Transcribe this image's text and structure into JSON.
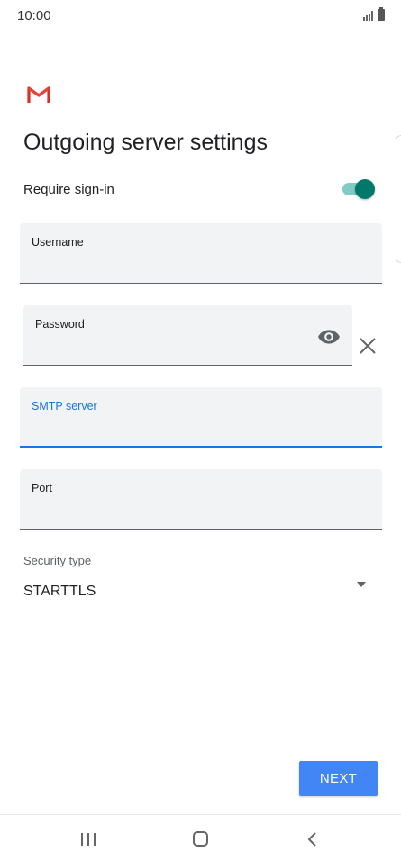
{
  "status_bar": {
    "time": "10:00"
  },
  "header": {
    "logo_icon": "gmail-logo-icon",
    "title": "Outgoing server settings"
  },
  "require_signin": {
    "label": "Require sign-in",
    "enabled": true
  },
  "fields": {
    "username": {
      "label": "Username",
      "value": ""
    },
    "password": {
      "label": "Password",
      "value": ""
    },
    "smtp_server": {
      "label": "SMTP server",
      "value": ""
    },
    "port": {
      "label": "Port",
      "value": ""
    }
  },
  "security": {
    "label": "Security type",
    "selected": "STARTTLS"
  },
  "actions": {
    "next_label": "NEXT"
  },
  "colors": {
    "accent_blue": "#1a73e8",
    "button_blue": "#4285f4",
    "toggle_teal": "#00796b",
    "gmail_red": "#d93025"
  }
}
